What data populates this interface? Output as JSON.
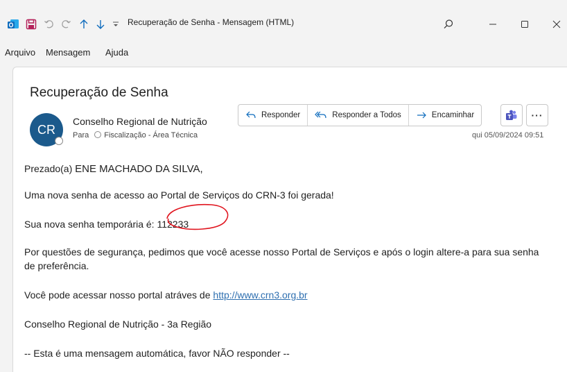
{
  "window": {
    "title": "Recuperação de Senha  -  Mensagem (HTML)",
    "icons": [
      "outlook-icon",
      "save-icon",
      "undo-icon",
      "redo-icon",
      "up-arrow-icon",
      "down-arrow-icon",
      "customize-quick-access-icon",
      "search-icon",
      "minimize-icon",
      "maximize-icon",
      "close-icon"
    ]
  },
  "menu": {
    "items": [
      "Arquivo",
      "Mensagem",
      "Ajuda"
    ]
  },
  "message": {
    "subject": "Recuperação de Senha",
    "avatar_initials": "CR",
    "sender": "Conselho Regional de Nutrição",
    "to_label": "Para",
    "to_recipient": "Fiscalização - Área Técnica",
    "date": "qui 05/09/2024 09:51",
    "actions": {
      "reply": "Responder",
      "reply_all": "Responder a Todos",
      "forward": "Encaminhar"
    }
  },
  "body": {
    "greeting": "Prezado(a) ",
    "recipient_name": "ENE MACHADO DA SILVA,",
    "line1": "Uma nova senha de acesso ao Portal de Serviços do CRN-3 foi gerada!",
    "line2_prefix": "Sua nova senha temporária é: ",
    "password": "112233",
    "line3": "Por questões de segurança, pedimos que você acesse nosso Portal de Serviços e após o login altere-a para sua senha de preferência.",
    "line4_prefix": "Você pode acessar nosso portal atráves de ",
    "link": "http://www.crn3.org.br",
    "line5": "Conselho Regional de Nutrição - 3a Região",
    "line6": "-- Esta é uma mensagem automática, favor NÃO responder --"
  },
  "colors": {
    "avatar": "#1b5a8c",
    "link": "#2e6fb0",
    "annotation": "#e0141e",
    "outlook_brand": "#0f6cbd",
    "save_icon": "#b4225a"
  }
}
